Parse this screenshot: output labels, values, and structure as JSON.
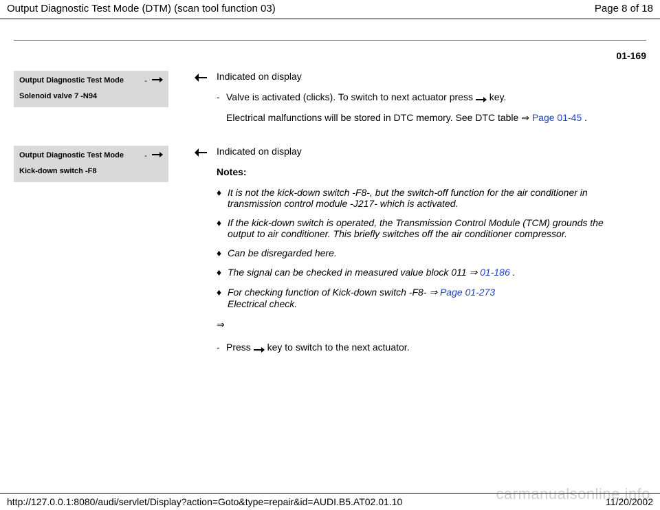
{
  "header": {
    "title": "Output Diagnostic Test Mode (DTM) (scan tool function 03)",
    "page_label": "Page 8 of 18"
  },
  "page_code": "01-169",
  "block1": {
    "display": {
      "line1": "Output Diagnostic Test Mode",
      "line2": "Solenoid valve 7 -N94"
    },
    "heading": "Indicated on display",
    "bullet_pre": "Valve is activated (clicks). To switch to next actuator press",
    "bullet_post": "key.",
    "para_pre": "Electrical malfunctions will be stored in DTC memory. See DTC table",
    "para_link": "Page 01-45",
    "para_post": "."
  },
  "block2": {
    "display": {
      "line1": "Output Diagnostic Test Mode",
      "line2": "Kick-down switch -F8"
    },
    "heading": "Indicated on display",
    "notes_label": "Notes:",
    "notes": [
      {
        "text": "It is not the kick-down switch -F8-, but the switch-off function for the air conditioner in transmission control module -J217- which is activated."
      },
      {
        "text": "If the kick-down switch is operated, the Transmission Control Module (TCM) grounds the output to air conditioner. This briefly switches off the air conditioner compressor."
      },
      {
        "text": "Can be disregarded here."
      },
      {
        "pre": "The signal can be checked in measured value block 011  ⇒",
        "link": "01-186",
        "post": " ."
      },
      {
        "pre": "For checking function of Kick-down switch -F8- ⇒",
        "link": "Page 01-273",
        "post2": "Electrical check."
      }
    ],
    "dbl_arrow": "⇒",
    "final_pre": "Press",
    "final_post": "key to switch to the next actuator."
  },
  "footer": {
    "url": "http://127.0.0.1:8080/audi/servlet/Display?action=Goto&type=repair&id=AUDI.B5.AT02.01.10",
    "date": "11/20/2002"
  },
  "watermark": "carmanualsonline.info"
}
